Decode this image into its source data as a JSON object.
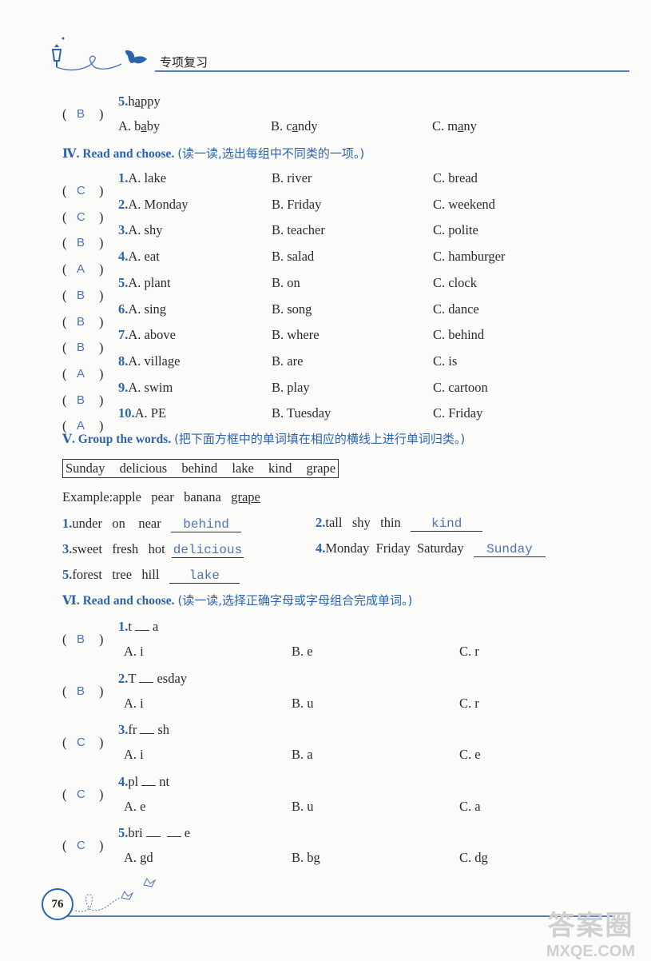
{
  "header": {
    "title": "专项复习"
  },
  "prev_item": {
    "answer": "B",
    "num": "5.",
    "word": "happy",
    "word_underline_index": 1,
    "options": [
      {
        "label": "A.",
        "pre": "b",
        "u": "a",
        "post": "by"
      },
      {
        "label": "B.",
        "pre": "c",
        "u": "a",
        "post": "ndy"
      },
      {
        "label": "C.",
        "pre": "m",
        "u": "a",
        "post": "ny"
      }
    ]
  },
  "section4": {
    "numeral": "Ⅳ.",
    "title": "Read and choose.",
    "instruction": "(读一读,选出每组中不同类的一项。)",
    "items": [
      {
        "answer": "C",
        "num": "1.",
        "a": "A. lake",
        "b": "B. river",
        "c": "C. bread"
      },
      {
        "answer": "C",
        "num": "2.",
        "a": "A. Monday",
        "b": "B. Friday",
        "c": "C. weekend"
      },
      {
        "answer": "B",
        "num": "3.",
        "a": "A. shy",
        "b": "B. teacher",
        "c": "C. polite"
      },
      {
        "answer": "A",
        "num": "4.",
        "a": "A. eat",
        "b": "B. salad",
        "c": "C. hamburger"
      },
      {
        "answer": "B",
        "num": "5.",
        "a": "A. plant",
        "b": "B. on",
        "c": "C. clock"
      },
      {
        "answer": "B",
        "num": "6.",
        "a": "A. sing",
        "b": "B. song",
        "c": "C. dance"
      },
      {
        "answer": "B",
        "num": "7.",
        "a": "A. above",
        "b": "B. where",
        "c": "C. behind"
      },
      {
        "answer": "A",
        "num": "8.",
        "a": "A. village",
        "b": "B. are",
        "c": "C. is"
      },
      {
        "answer": "B",
        "num": "9.",
        "a": "A. swim",
        "b": "B. play",
        "c": "C. cartoon"
      },
      {
        "answer": "A",
        "num": "10.",
        "a": "A. PE",
        "b": "B. Tuesday",
        "c": "C. Friday"
      }
    ]
  },
  "section5": {
    "numeral": "Ⅴ.",
    "title": "Group the words.",
    "instruction": "(把下面方框中的单词填在相应的横线上进行单词归类。)",
    "word_box": [
      "Sunday",
      "delicious",
      "behind",
      "lake",
      "kind",
      "grape"
    ],
    "example": {
      "label": "Example:",
      "words": "apple   pear   banana",
      "answer": "grape"
    },
    "items": [
      {
        "num": "1.",
        "words": "under   on    near",
        "answer": "behind"
      },
      {
        "num": "2.",
        "words": "tall   shy   thin",
        "answer": "kind"
      },
      {
        "num": "3.",
        "words": "sweet   fresh   hot",
        "answer": "delicious"
      },
      {
        "num": "4.",
        "words": "Monday  Friday  Saturday",
        "answer": "Sunday"
      },
      {
        "num": "5.",
        "words": "forest   tree   hill",
        "answer": "lake"
      }
    ]
  },
  "section6": {
    "numeral": "Ⅵ.",
    "title": "Read and choose.",
    "instruction": "(读一读,选择正确字母或字母组合完成单词。)",
    "items": [
      {
        "answer": "B",
        "num": "1.",
        "pre": "t",
        "blanks": 1,
        "post": "a",
        "a": "A. i",
        "b": "B. e",
        "c": "C. r"
      },
      {
        "answer": "B",
        "num": "2.",
        "pre": "T",
        "blanks": 1,
        "post": "esday",
        "a": "A. i",
        "b": "B. u",
        "c": "C. r"
      },
      {
        "answer": "C",
        "num": "3.",
        "pre": "fr",
        "blanks": 1,
        "post": "sh",
        "a": "A. i",
        "b": "B. a",
        "c": "C. e"
      },
      {
        "answer": "C",
        "num": "4.",
        "pre": "pl",
        "blanks": 1,
        "post": "nt",
        "a": "A. e",
        "b": "B. u",
        "c": "C. a"
      },
      {
        "answer": "C",
        "num": "5.",
        "pre": "bri",
        "blanks": 2,
        "post": "e",
        "a": "A. gd",
        "b": "B. bg",
        "c": "C. dg"
      }
    ]
  },
  "footer": {
    "page_number": "76"
  },
  "watermark": {
    "line1": "答案圈",
    "line2": "MXQE.COM"
  }
}
